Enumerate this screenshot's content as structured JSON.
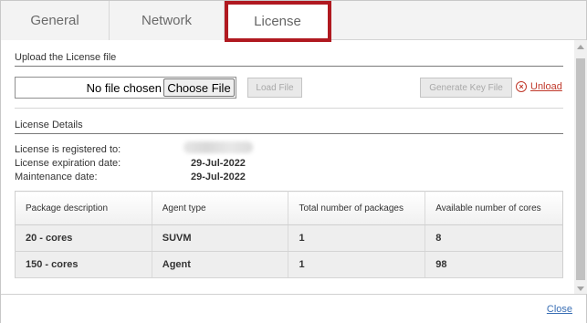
{
  "tabs": [
    {
      "label": "General",
      "active": false
    },
    {
      "label": "Network",
      "active": false
    },
    {
      "label": "License",
      "active": true
    }
  ],
  "upload": {
    "title": "Upload the License file",
    "file_status": "No file chosen",
    "choose_label": "Choose File",
    "load_label": "Load File",
    "generate_label": "Generate Key File",
    "unload_label": "Unload"
  },
  "details": {
    "title": "License Details",
    "registered_label": "License is registered to:",
    "expiration_label": "License expiration date:",
    "expiration_value": "29-Jul-2022",
    "maintenance_label": "Maintenance date:",
    "maintenance_value": "29-Jul-2022"
  },
  "table": {
    "headers": [
      "Package description",
      "Agent type",
      "Total number of packages",
      "Available number of cores"
    ],
    "rows": [
      [
        "20 - cores",
        "SUVM",
        "1",
        "8"
      ],
      [
        "150 - cores",
        "Agent",
        "1",
        "98"
      ]
    ]
  },
  "footer": {
    "close_label": "Close"
  },
  "colors": {
    "highlight": "#b01920",
    "unload": "#c0392b",
    "link": "#3a6fb5"
  }
}
